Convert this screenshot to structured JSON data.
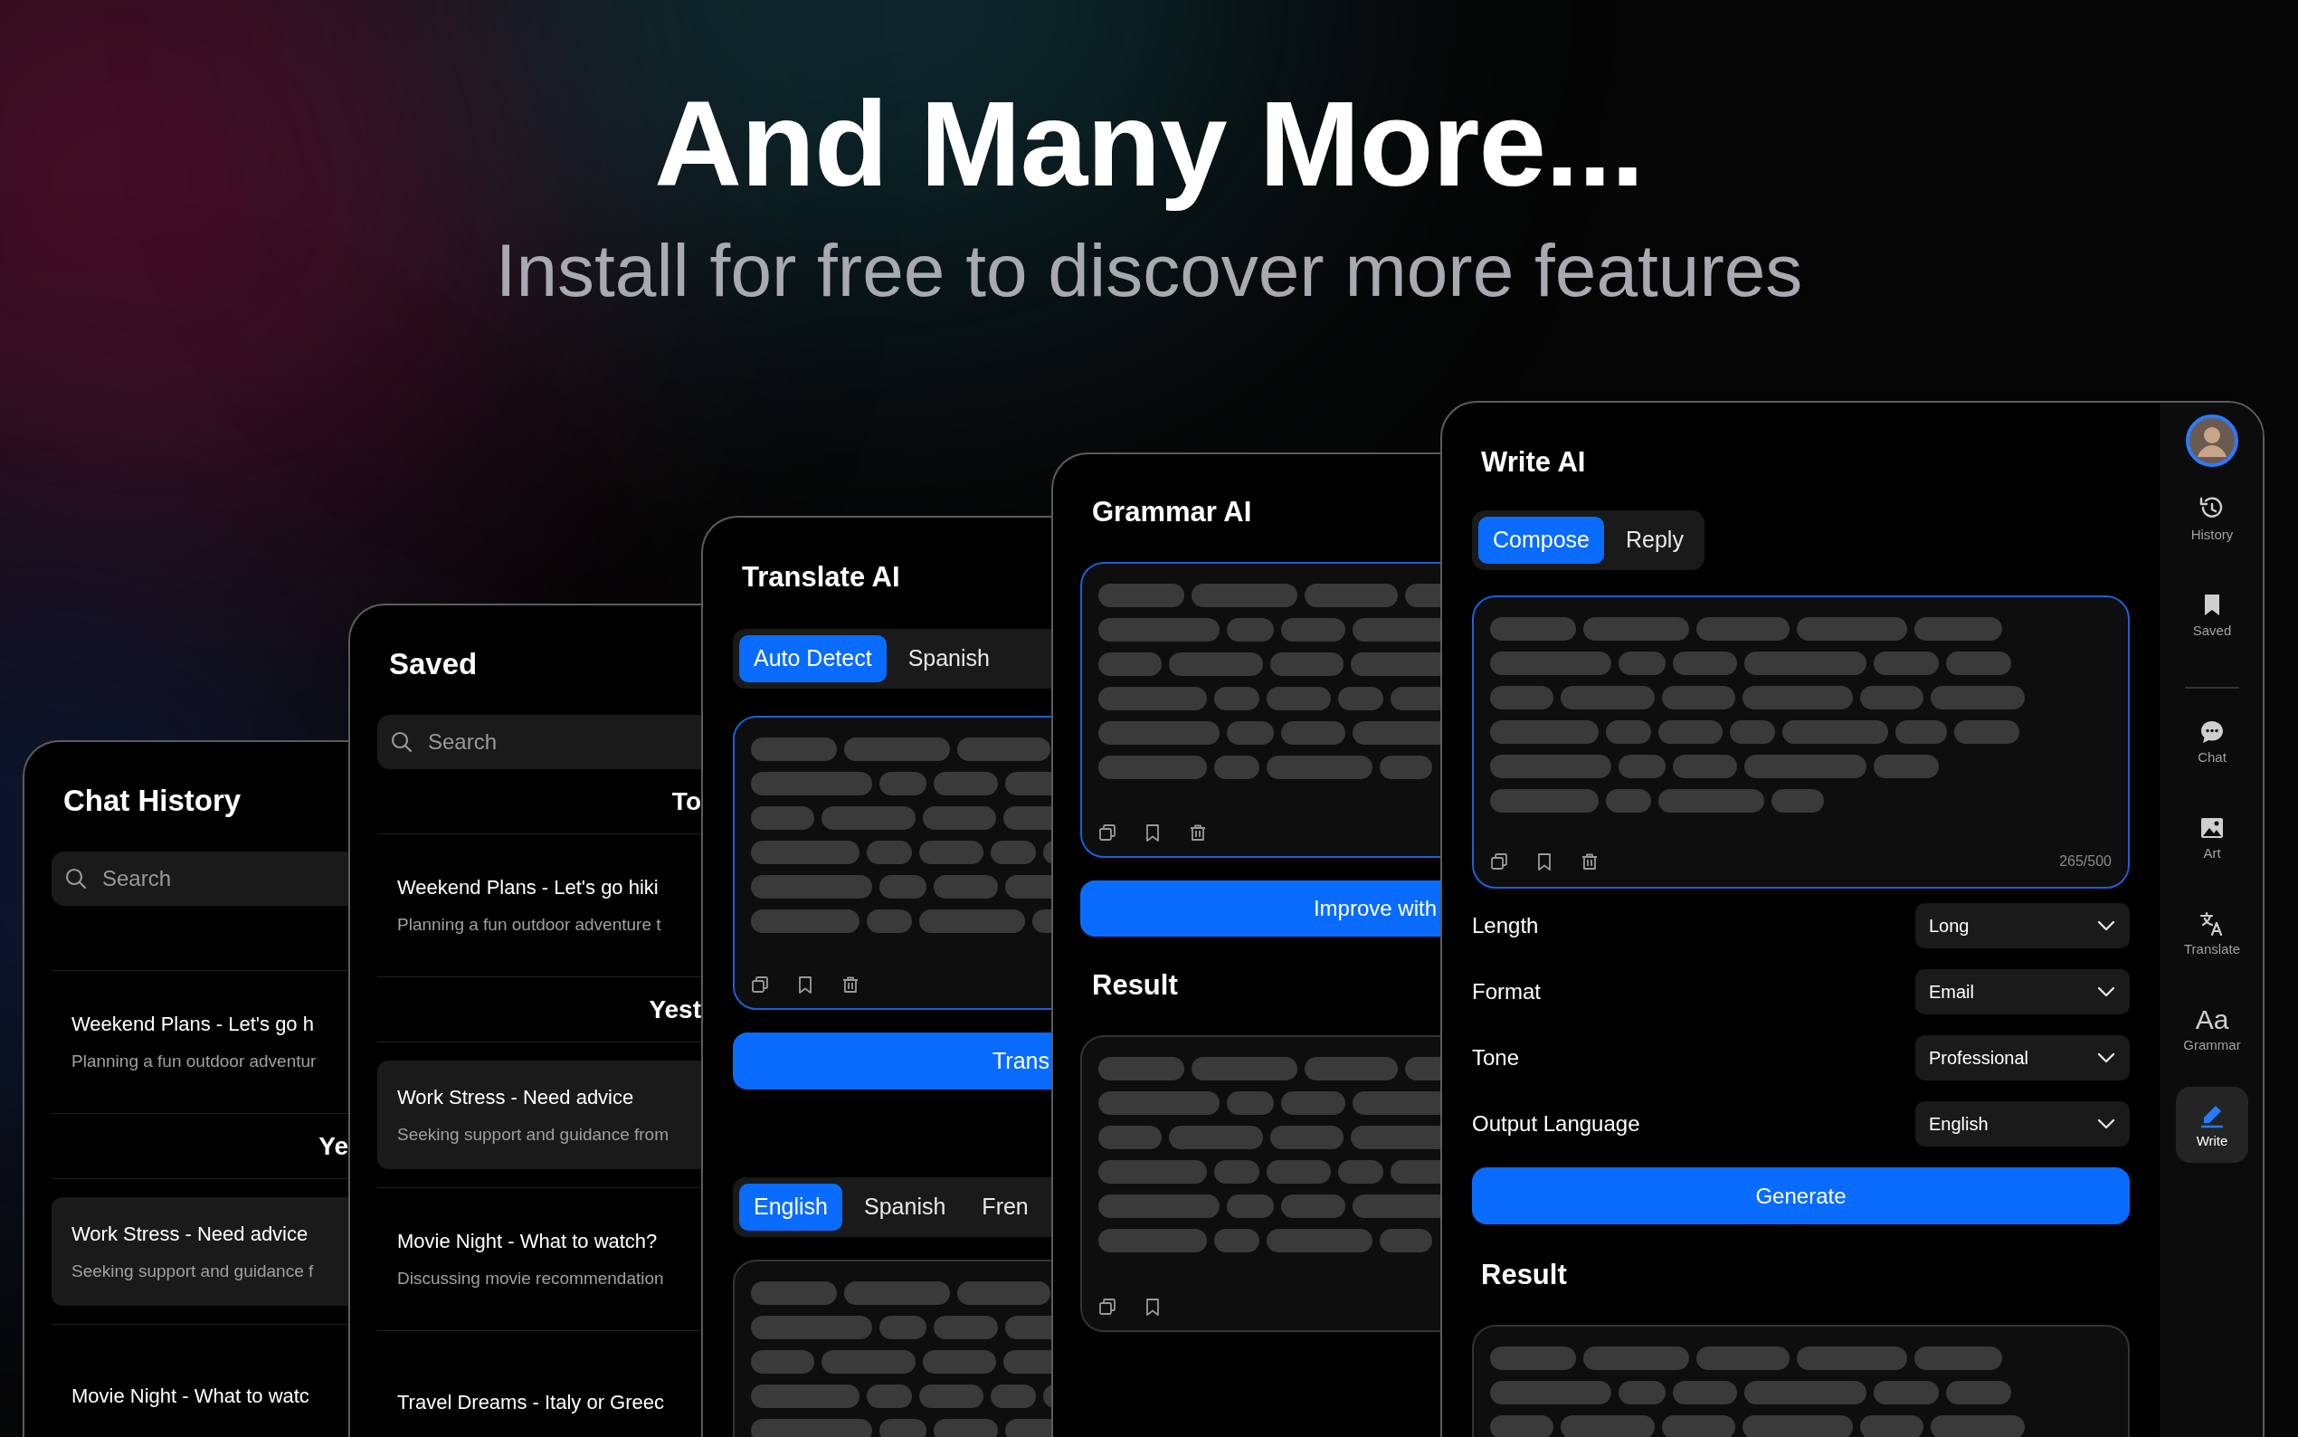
{
  "headline": "And Many More...",
  "subheadline": "Install for free to discover more features",
  "screens": [
    {
      "kind": "history",
      "title": "Chat History",
      "search": {
        "placeholder": "Search"
      },
      "entries": [
        {
          "kind": "chat",
          "title": "Weekend Plans - Let's go h",
          "subtitle": "Planning a fun outdoor adventur",
          "selected": false
        },
        {
          "kind": "section",
          "label": "Ye"
        },
        {
          "kind": "chat",
          "title": "Work Stress - Need advice",
          "subtitle": "Seeking support and guidance f",
          "selected": true
        },
        {
          "kind": "chat",
          "title": "Movie Night - What to watc",
          "selected": false
        }
      ]
    },
    {
      "kind": "history",
      "title": "Saved",
      "search": {
        "placeholder": "Search"
      },
      "entries": [
        {
          "kind": "section",
          "label": "To"
        },
        {
          "kind": "chat",
          "title": "Weekend Plans - Let's go hiki",
          "subtitle": "Planning a fun outdoor adventure t",
          "selected": false
        },
        {
          "kind": "section",
          "label": "Yest"
        },
        {
          "kind": "chat",
          "title": "Work Stress - Need advice",
          "subtitle": "Seeking support and guidance from",
          "selected": true
        },
        {
          "kind": "chat",
          "title": "Movie Night - What to watch?",
          "subtitle": "Discussing movie recommendation",
          "selected": false
        },
        {
          "kind": "chat",
          "title": "Travel Dreams - Italy or Greec",
          "selected": false
        }
      ]
    },
    {
      "kind": "translate",
      "title": "Translate AI",
      "source_tabs": [
        {
          "label": "Auto Detect",
          "selected": true
        },
        {
          "label": "Spanish",
          "selected": false
        }
      ],
      "button": "Trans",
      "target_tabs": [
        {
          "label": "English",
          "selected": true
        },
        {
          "label": "Spanish",
          "selected": false
        },
        {
          "label": "Fren",
          "selected": false
        }
      ]
    },
    {
      "kind": "grammar",
      "title": "Grammar AI",
      "button": "Improve with",
      "result_title": "Result"
    },
    {
      "kind": "write",
      "title": "Write AI",
      "tabs": [
        {
          "label": "Compose",
          "selected": true
        },
        {
          "label": "Reply",
          "selected": false
        }
      ],
      "counter": "265/500",
      "settings": [
        {
          "label": "Length",
          "value": "Long"
        },
        {
          "label": "Format",
          "value": "Email"
        },
        {
          "label": "Tone",
          "value": "Professional"
        },
        {
          "label": "Output Language",
          "value": "English"
        }
      ],
      "button": "Generate",
      "result_title": "Result",
      "sidebar": [
        {
          "label": "History",
          "selected": false
        },
        {
          "label": "Saved",
          "selected": false
        },
        {
          "label": "Chat",
          "selected": false
        },
        {
          "label": "Art",
          "selected": false
        },
        {
          "label": "Translate",
          "selected": false
        },
        {
          "label": "Grammar",
          "glyph": "Aa",
          "selected": false
        },
        {
          "label": "Write",
          "selected": true
        }
      ]
    }
  ]
}
